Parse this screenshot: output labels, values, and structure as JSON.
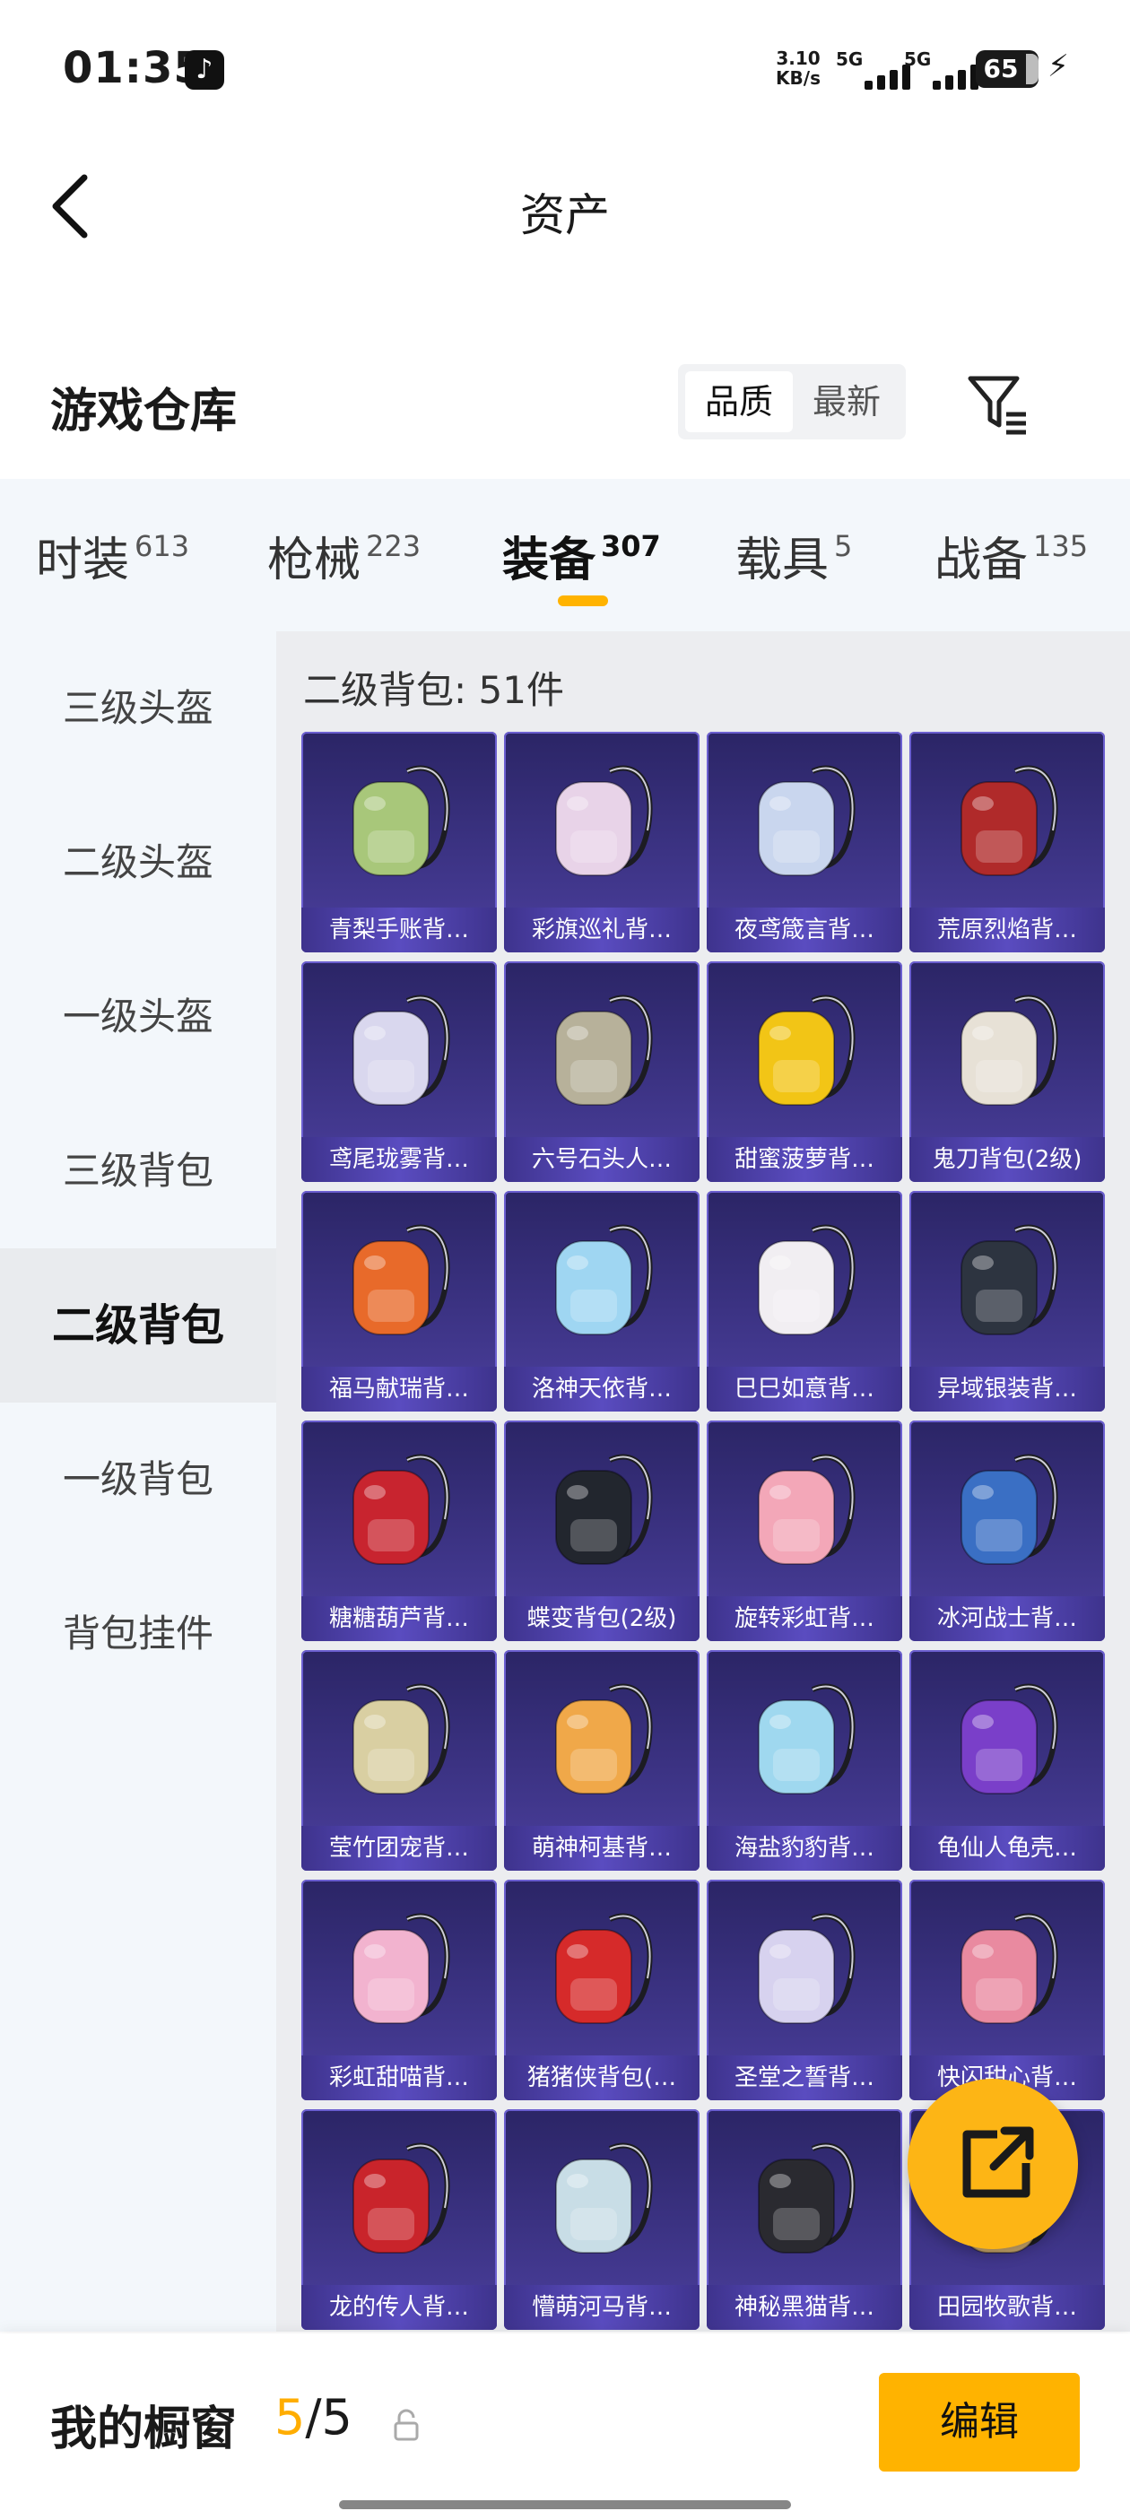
{
  "status_bar": {
    "time": "01:35",
    "app_badge": "♪",
    "net_speed_value": "3.10",
    "net_speed_unit": "KB/s",
    "sim1_label": "5G",
    "sim2_label": "5G",
    "battery": "65"
  },
  "nav": {
    "title": "资产"
  },
  "warehouse": {
    "title": "游戏仓库",
    "sort_options": [
      "品质",
      "最新"
    ],
    "sort_active": "品质"
  },
  "category_tabs": [
    {
      "label": "时装",
      "count": "613"
    },
    {
      "label": "枪械",
      "count": "223"
    },
    {
      "label": "装备",
      "count": "307"
    },
    {
      "label": "载具",
      "count": "5"
    },
    {
      "label": "战备",
      "count": "135"
    }
  ],
  "sidebar": {
    "items": [
      {
        "label": "三级头盔"
      },
      {
        "label": "二级头盔"
      },
      {
        "label": "一级头盔"
      },
      {
        "label": "三级背包"
      },
      {
        "label": "二级背包"
      },
      {
        "label": "一级背包"
      },
      {
        "label": "背包挂件"
      }
    ],
    "active": "二级背包"
  },
  "content": {
    "title": "二级背包: 51件",
    "items": [
      {
        "name": "青梨手账背…",
        "color": "#a8c77a"
      },
      {
        "name": "彩旗巡礼背…",
        "color": "#e8d3e8"
      },
      {
        "name": "夜鸢箴言背…",
        "color": "#c9d6ee"
      },
      {
        "name": "荒原烈焰背…",
        "color": "#b02a2a"
      },
      {
        "name": "鸢尾珑雾背…",
        "color": "#d9d7ee"
      },
      {
        "name": "六号石头人…",
        "color": "#b7b19a"
      },
      {
        "name": "甜蜜菠萝背…",
        "color": "#f2c516"
      },
      {
        "name": "鬼刀背包(2级)",
        "color": "#e7e1d6"
      },
      {
        "name": "福马献瑞背…",
        "color": "#e86a2a"
      },
      {
        "name": "洛神天依背…",
        "color": "#9fd6f2"
      },
      {
        "name": "巳巳如意背…",
        "color": "#f1eef2"
      },
      {
        "name": "异域银装背…",
        "color": "#2d3440"
      },
      {
        "name": "糖糖葫芦背…",
        "color": "#c8242f"
      },
      {
        "name": "蝶变背包(2级)",
        "color": "#22262e"
      },
      {
        "name": "旋转彩虹背…",
        "color": "#f3a7b8"
      },
      {
        "name": "冰河战士背…",
        "color": "#3a6fc4"
      },
      {
        "name": "莹竹团宠背…",
        "color": "#d9cfa2"
      },
      {
        "name": "萌神柯基背…",
        "color": "#f0a849"
      },
      {
        "name": "海盐豹豹背…",
        "color": "#9fd8ef"
      },
      {
        "name": "龟仙人龟壳…",
        "color": "#7a3fc9"
      },
      {
        "name": "彩虹甜喵背…",
        "color": "#f2b3cf"
      },
      {
        "name": "猪猪侠背包(…",
        "color": "#d62a2a"
      },
      {
        "name": "圣堂之誓背…",
        "color": "#d7d2ef"
      },
      {
        "name": "快闪甜心背…",
        "color": "#e98aa0"
      },
      {
        "name": "龙的传人背…",
        "color": "#c9242b"
      },
      {
        "name": "懵萌河马背…",
        "color": "#c8dde6"
      },
      {
        "name": "神秘黑猫背…",
        "color": "#2a2a30"
      },
      {
        "name": "田园牧歌背…",
        "color": "#c9a66b"
      }
    ]
  },
  "bottom_bar": {
    "window_label": "我的橱窗",
    "window_current": "5",
    "window_total": "/5",
    "edit_label": "编辑"
  },
  "colors": {
    "accent": "#ffb300",
    "card_bg": "#3c3384",
    "panel_bg": "#f3f7fb"
  }
}
